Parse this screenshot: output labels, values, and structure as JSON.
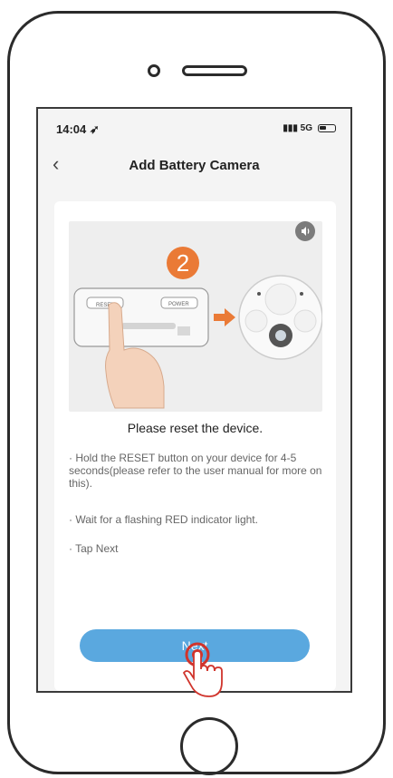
{
  "status_bar": {
    "time": "14:04",
    "network": "5G"
  },
  "nav": {
    "title": "Add Battery Camera"
  },
  "illustration": {
    "step_number": "2",
    "device_labels": {
      "reset": "RESET",
      "power": "POWER"
    }
  },
  "content": {
    "headline": "Please reset the device.",
    "instructions": [
      "· Hold the RESET button on your device for 4-5 seconds(please refer to the user manual for more on this).",
      "· Wait for a flashing RED indicator light.",
      "· Tap Next"
    ]
  },
  "next_button": {
    "label": "Next"
  },
  "colors": {
    "accent": "#5aa8df",
    "step_badge": "#ea7a36",
    "tap_marker": "#d0342c"
  }
}
